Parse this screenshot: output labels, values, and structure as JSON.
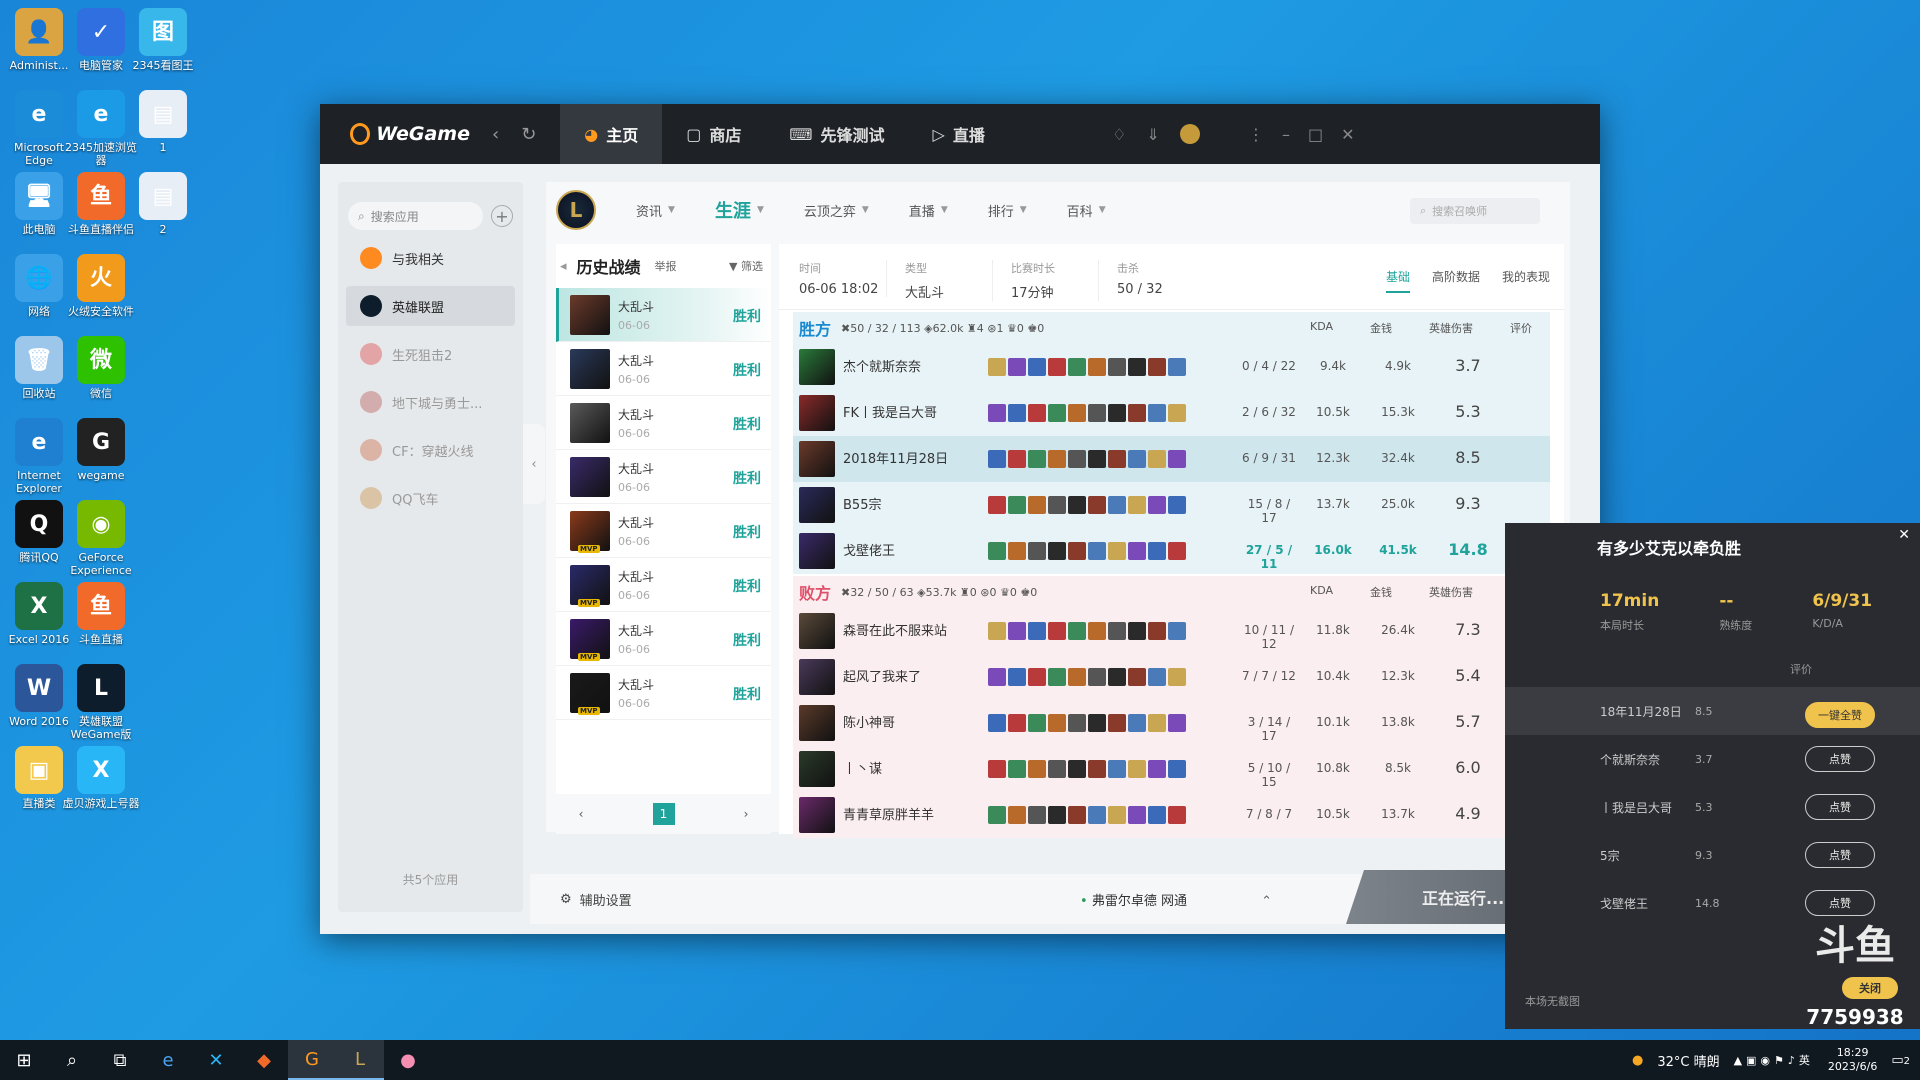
{
  "desktop": {
    "icons": [
      {
        "label": "Administ...",
        "x": 0,
        "y": 0,
        "color": "#d9a441",
        "glyph": "👤"
      },
      {
        "label": "电脑管家",
        "color": "#2f6fe0",
        "glyph": "✓"
      },
      {
        "label": "2345看图王",
        "color": "#38b7ea",
        "glyph": "图"
      },
      {
        "label": "Microsoft Edge",
        "color": "#1a8cd8",
        "glyph": "e"
      },
      {
        "label": "2345加速浏览器",
        "color": "#1b9be5",
        "glyph": "e"
      },
      {
        "label": "1",
        "color": "#e8eef5",
        "glyph": "▤"
      },
      {
        "label": "此电脑",
        "color": "#3aa0e8",
        "glyph": "🖥"
      },
      {
        "label": "斗鱼直播伴侣",
        "color": "#f26a2a",
        "glyph": "鱼"
      },
      {
        "label": "2",
        "color": "#e8eef5",
        "glyph": "▤"
      },
      {
        "label": "网络",
        "color": "#3aa0e8",
        "glyph": "🌐"
      },
      {
        "label": "火绒安全软件",
        "color": "#f29a1c",
        "glyph": "火"
      },
      {
        "label": "回收站",
        "color": "#9cc6ea",
        "glyph": "🗑"
      },
      {
        "label": "微信",
        "color": "#2dc100",
        "glyph": "微"
      },
      {
        "label": "Internet Explorer",
        "color": "#1f7fd1",
        "glyph": "e"
      },
      {
        "label": "wegame",
        "color": "#222",
        "glyph": "G"
      },
      {
        "label": "腾讯QQ",
        "color": "#111",
        "glyph": "Q"
      },
      {
        "label": "GeForce Experience",
        "color": "#76b900",
        "glyph": "◉"
      },
      {
        "label": "Excel 2016",
        "color": "#1e7145",
        "glyph": "X"
      },
      {
        "label": "斗鱼直播",
        "color": "#f26a2a",
        "glyph": "鱼"
      },
      {
        "label": "Word 2016",
        "color": "#2b579a",
        "glyph": "W"
      },
      {
        "label": "英雄联盟WeGame版",
        "color": "#0e1d2c",
        "glyph": "L"
      },
      {
        "label": "直播类",
        "color": "#f2c94c",
        "glyph": "▣"
      },
      {
        "label": "虚贝游戏上号器",
        "color": "#29b6f6",
        "glyph": "X"
      }
    ]
  },
  "window": {
    "logo": "WeGame",
    "tabs": [
      {
        "label": "主页",
        "icon": "pacman-icon",
        "active": true
      },
      {
        "label": "商店",
        "icon": "bag-icon"
      },
      {
        "label": "先锋测试",
        "icon": "gamepad-icon"
      },
      {
        "label": "直播",
        "icon": "play-icon"
      }
    ]
  },
  "sidebar": {
    "search_placeholder": "搜索应用",
    "apps": [
      {
        "label": "与我相关",
        "color": "#ff8a1f"
      },
      {
        "label": "英雄联盟",
        "color": "#0e1d2c"
      },
      {
        "label": "生死狙击2",
        "color": "#e06060"
      },
      {
        "label": "地下城与勇士...",
        "color": "#c07070"
      },
      {
        "label": "CF：穿越火线",
        "color": "#d08060"
      },
      {
        "label": "QQ飞车",
        "color": "#d0a060"
      }
    ],
    "count": "共5个应用"
  },
  "lolnav": {
    "items": [
      "资讯",
      "生涯",
      "云顶之弈",
      "直播",
      "排行",
      "百科"
    ],
    "search_placeholder": "搜索召唤师"
  },
  "history": {
    "title": "历史战绩",
    "report": "举报",
    "filter": "筛选",
    "matches": [
      {
        "mode": "大乱斗",
        "date": "06-06",
        "result": "胜利",
        "color": "#6b3a2a",
        "mvp": false
      },
      {
        "mode": "大乱斗",
        "date": "06-06",
        "result": "胜利",
        "color": "#2a3a5a",
        "mvp": false
      },
      {
        "mode": "大乱斗",
        "date": "06-06",
        "result": "胜利",
        "color": "#5a5a5a",
        "mvp": false
      },
      {
        "mode": "大乱斗",
        "date": "06-06",
        "result": "胜利",
        "color": "#3a2a6a",
        "mvp": false
      },
      {
        "mode": "大乱斗",
        "date": "06-06",
        "result": "胜利",
        "color": "#8a3a1a",
        "mvp": true
      },
      {
        "mode": "大乱斗",
        "date": "06-06",
        "result": "胜利",
        "color": "#2a2a6a",
        "mvp": true
      },
      {
        "mode": "大乱斗",
        "date": "06-06",
        "result": "胜利",
        "color": "#3a1a6a",
        "mvp": true
      },
      {
        "mode": "大乱斗",
        "date": "06-06",
        "result": "胜利",
        "color": "#1a1a1a",
        "mvp": true
      }
    ],
    "page": "1"
  },
  "detail": {
    "time_label": "时间",
    "time": "06-06 18:02",
    "type_label": "类型",
    "type": "大乱斗",
    "dur_label": "比赛时长",
    "dur": "17分钟",
    "kills_label": "击杀",
    "kills": "50 / 32",
    "tabs": [
      "基础",
      "高阶数据",
      "我的表现"
    ],
    "cols": [
      "KDA",
      "金钱",
      "英雄伤害",
      "评价"
    ],
    "win": {
      "label": "胜方",
      "stats": "✖50 / 32 / 113  ◈62.0k  ♜4  ⊛1  ♛0  ♚0",
      "players": [
        {
          "name": "杰个就斯奈奈",
          "kda": "0 / 4 / 22",
          "gold": "9.4k",
          "dmg": "4.9k",
          "score": "3.7",
          "color": "#2a7a3a"
        },
        {
          "name": "FK丨我是吕大哥",
          "kda": "2 / 6 / 32",
          "gold": "10.5k",
          "dmg": "15.3k",
          "score": "5.3",
          "color": "#8a2a2a"
        },
        {
          "name": "2018年11月28日",
          "kda": "6 / 9 / 31",
          "gold": "12.3k",
          "dmg": "32.4k",
          "score": "8.5",
          "color": "#6b3a2a",
          "me": true
        },
        {
          "name": "B55宗",
          "kda": "15 / 8 / 17",
          "gold": "13.7k",
          "dmg": "25.0k",
          "score": "9.3",
          "color": "#2a2a5a"
        },
        {
          "name": "戈壁佬王",
          "kda": "27 / 5 / 11",
          "gold": "16.0k",
          "dmg": "41.5k",
          "score": "14.8",
          "color": "#3a2a6a",
          "best": true
        }
      ]
    },
    "lose": {
      "label": "败方",
      "stats": "✖32 / 50 / 63  ◈53.7k  ♜0  ⊛0  ♛0  ♚0",
      "players": [
        {
          "name": "森哥在此不服来站",
          "kda": "10 / 11 / 12",
          "gold": "11.8k",
          "dmg": "26.4k",
          "score": "7.3",
          "color": "#5a4a3a"
        },
        {
          "name": "起风了我来了",
          "kda": "7 / 7 / 12",
          "gold": "10.4k",
          "dmg": "12.3k",
          "score": "5.4",
          "color": "#4a3a5a"
        },
        {
          "name": "陈小神哥",
          "kda": "3 / 14 / 17",
          "gold": "10.1k",
          "dmg": "13.8k",
          "score": "5.7",
          "color": "#5a3a2a"
        },
        {
          "name": "丨丶谋",
          "kda": "5 / 10 / 15",
          "gold": "10.8k",
          "dmg": "8.5k",
          "score": "6.0",
          "color": "#2a3a2a"
        },
        {
          "name": "青青草原胖羊羊",
          "kda": "7 / 8 / 7",
          "gold": "10.5k",
          "dmg": "13.7k",
          "score": "4.9",
          "color": "#6a2a6a"
        }
      ]
    }
  },
  "bottom": {
    "helper": "辅助设置",
    "server": "弗雷尔卓德 网通",
    "running": "正在运行..."
  },
  "overlay": {
    "title": "有多少艾克以牵负胜",
    "stats": [
      {
        "v": "17min",
        "k": "本局时长"
      },
      {
        "v": "--",
        "k": "熟练度"
      },
      {
        "v": "6/9/31",
        "k": "K/D/A"
      }
    ],
    "score_label": "评价",
    "rows": [
      {
        "name": "18年11月28日",
        "score": "8.5",
        "btn": "一键全赞"
      },
      {
        "name": "个就斯奈奈",
        "score": "3.7",
        "btn": "点赞"
      },
      {
        "name": "丨我是吕大哥",
        "score": "5.3",
        "btn": "点赞"
      },
      {
        "name": "5宗",
        "score": "9.3",
        "btn": "点赞"
      },
      {
        "name": "戈壁佬王",
        "score": "14.8",
        "btn": "点赞"
      }
    ],
    "no_screenshot": "本场无截图",
    "close": "关闭",
    "room": "7759938",
    "brand": "斗鱼"
  },
  "taskbar": {
    "weather": "32°C 晴朗",
    "time": "18:29",
    "date": "2023/6/6",
    "notif": "2"
  }
}
